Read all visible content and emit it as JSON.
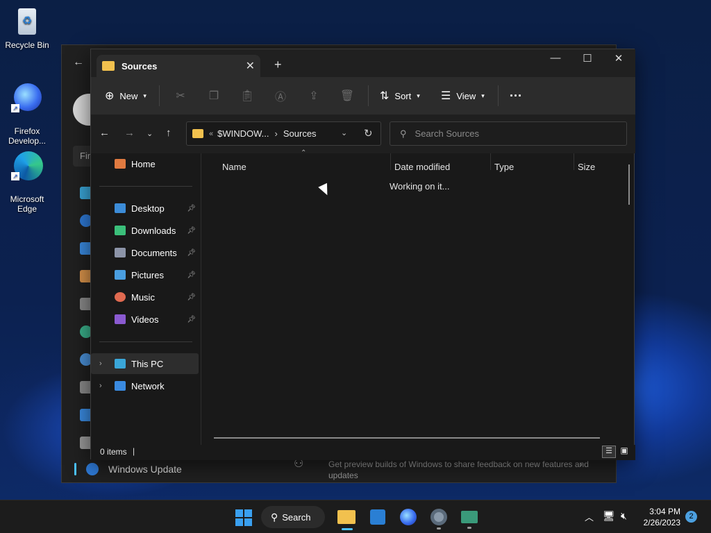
{
  "desktop": {
    "icons": [
      {
        "label": "Recycle Bin",
        "icon": "recycle-bin-icon"
      },
      {
        "label": "Firefox\nDevelop...",
        "icon": "firefox-developer-icon"
      },
      {
        "label": "Microsoft\nEdge",
        "icon": "edge-icon"
      }
    ]
  },
  "settings_window": {
    "search_placeholder": "Fin",
    "windows_update_label": "Windows Update",
    "insider_text": "Get preview builds of Windows to share feedback on new features and updates"
  },
  "explorer": {
    "tab_title": "Sources",
    "toolbar": {
      "new_label": "New",
      "sort_label": "Sort",
      "view_label": "View"
    },
    "address": {
      "segments": [
        "$WINDOW...",
        "Sources"
      ]
    },
    "search_placeholder": "Search Sources",
    "nav": {
      "home": "Home",
      "quick_access": [
        {
          "label": "Desktop",
          "icon": "desktop-icon",
          "color": "#3c8cd8"
        },
        {
          "label": "Downloads",
          "icon": "downloads-icon",
          "color": "#3bbf7a"
        },
        {
          "label": "Documents",
          "icon": "documents-icon",
          "color": "#8c94a8"
        },
        {
          "label": "Pictures",
          "icon": "pictures-icon",
          "color": "#4a9ee0"
        },
        {
          "label": "Music",
          "icon": "music-icon",
          "color": "#e06a50"
        },
        {
          "label": "Videos",
          "icon": "videos-icon",
          "color": "#8a5ad0"
        }
      ],
      "this_pc": "This PC",
      "network": "Network"
    },
    "columns": [
      "Name",
      "Date modified",
      "Type",
      "Size"
    ],
    "status_message": "Working on it...",
    "item_count": "0 items"
  },
  "taskbar": {
    "search_label": "Search",
    "time": "3:04 PM",
    "date": "2/26/2023",
    "notification_count": "2"
  }
}
